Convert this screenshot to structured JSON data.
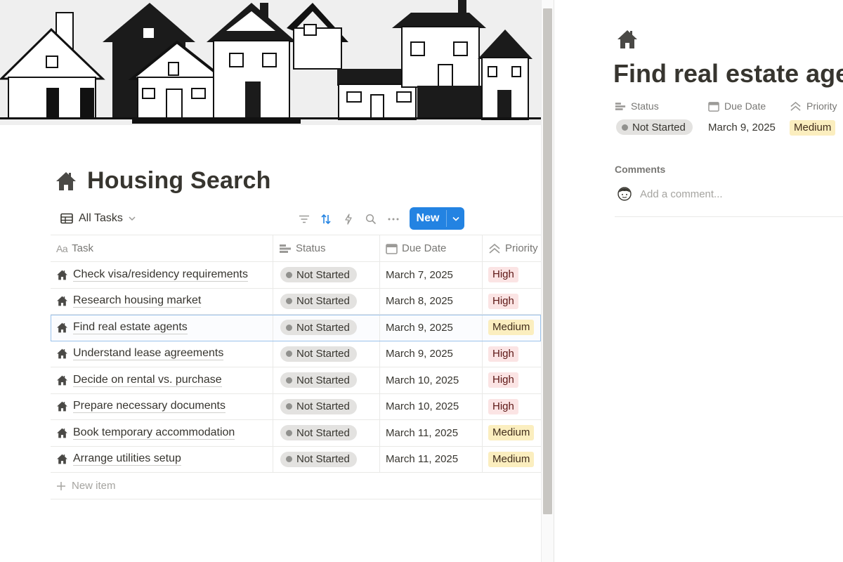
{
  "page": {
    "title": "Housing Search"
  },
  "toolbar": {
    "view_label": "All Tasks",
    "new_label": "New",
    "icons": [
      "filter-icon",
      "sort-icon",
      "automation-icon",
      "search-icon",
      "more-icon"
    ]
  },
  "table": {
    "columns": [
      {
        "key": "task",
        "label": "Task",
        "icon": "Aa"
      },
      {
        "key": "status",
        "label": "Status",
        "icon": "status-icon"
      },
      {
        "key": "due",
        "label": "Due Date",
        "icon": "calendar-icon"
      },
      {
        "key": "priority",
        "label": "Priority",
        "icon": "priority-icon"
      }
    ],
    "rows": [
      {
        "task": "Check visa/residency requirements",
        "status": "Not Started",
        "due": "March 7, 2025",
        "priority": "High"
      },
      {
        "task": "Research housing market",
        "status": "Not Started",
        "due": "March 8, 2025",
        "priority": "High"
      },
      {
        "task": "Find real estate agents",
        "status": "Not Started",
        "due": "March 9, 2025",
        "priority": "Medium"
      },
      {
        "task": "Understand lease agreements",
        "status": "Not Started",
        "due": "March 9, 2025",
        "priority": "High"
      },
      {
        "task": "Decide on rental vs. purchase",
        "status": "Not Started",
        "due": "March 10, 2025",
        "priority": "High"
      },
      {
        "task": "Prepare necessary documents",
        "status": "Not Started",
        "due": "March 10, 2025",
        "priority": "High"
      },
      {
        "task": "Book temporary accommodation",
        "status": "Not Started",
        "due": "March 11, 2025",
        "priority": "Medium"
      },
      {
        "task": "Arrange utilities setup",
        "status": "Not Started",
        "due": "March 11, 2025",
        "priority": "Medium"
      }
    ],
    "selected_index": 2,
    "new_item_label": "New item"
  },
  "priority_colors": {
    "High": {
      "bg": "#fbe4e4",
      "fg": "#5d1715"
    },
    "Medium": {
      "bg": "#fbeebf",
      "fg": "#402c1b"
    }
  },
  "detail": {
    "title": "Find real estate agents",
    "props": {
      "status_label": "Status",
      "due_label": "Due Date",
      "priority_label": "Priority"
    },
    "status": "Not Started",
    "due": "March 9, 2025",
    "priority": "Medium",
    "comments_label": "Comments",
    "comment_placeholder": "Add a comment..."
  },
  "colors": {
    "accent": "#2383e2",
    "text": "#37352f",
    "muted": "#787774"
  }
}
